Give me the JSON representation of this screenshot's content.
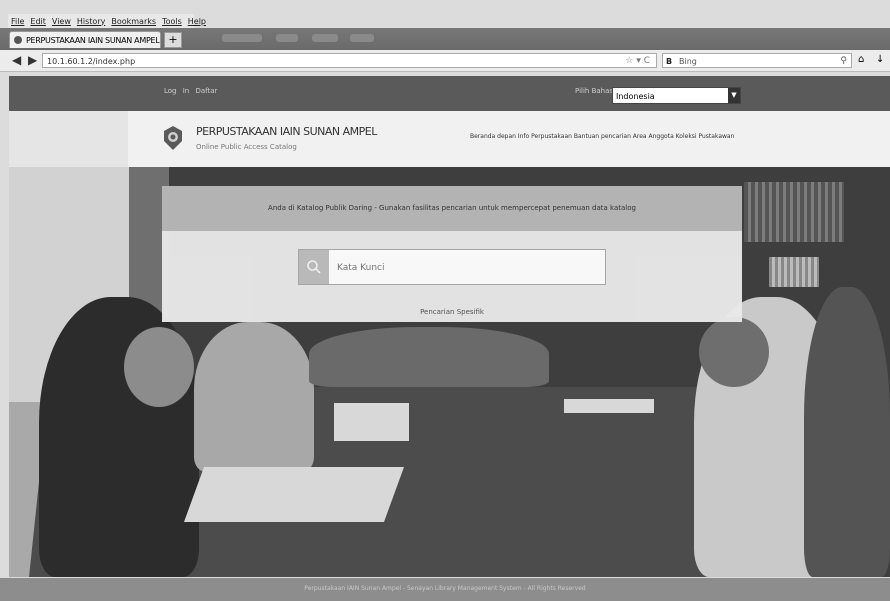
{
  "browser": {
    "menu": [
      "File",
      "Edit",
      "View",
      "History",
      "Bookmarks",
      "Tools",
      "Help"
    ],
    "tab_title": "PERPUSTAKAAN IAIN SUNAN AMPEL",
    "tab_close": "×",
    "new_tab": "+",
    "url": "10.1.60.1.2/index.php",
    "search_engine_mark": "B",
    "search_placeholder": "Bing"
  },
  "site": {
    "top_links": "Log In   Daftar",
    "language_label": "Pilih Bahasa",
    "language_value": "Indonesia",
    "title": "PERPUSTAKAAN IAIN SUNAN AMPEL",
    "subtitle": "Online Public Access Catalog",
    "nav": "Beranda depan   Info Perpustakaan   Bantuan pencarian   Area Anggota   Koleksi Pustakawan"
  },
  "search_panel": {
    "heading": "Anda di Katalog Publik Daring - Gunakan fasilitas pencarian untuk mempercepat penemuan data katalog",
    "placeholder": "Kata Kunci",
    "advanced_link": "Pencarian Spesifik"
  },
  "footer": {
    "text": "Perpustakaan IAIN Sunan Ampel - Senayan Library Management System - All Rights Reserved"
  }
}
